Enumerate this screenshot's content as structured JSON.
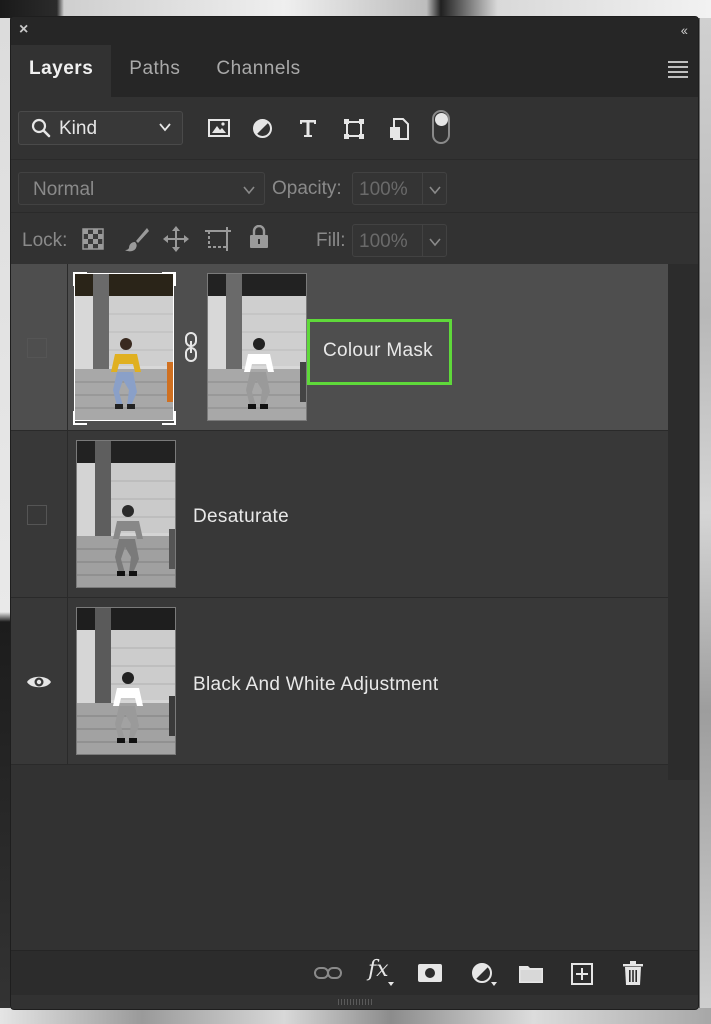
{
  "window": {
    "close_glyph": "×",
    "collapse_glyph": "‹‹"
  },
  "tabs": [
    {
      "label": "Layers",
      "active": true
    },
    {
      "label": "Paths",
      "active": false
    },
    {
      "label": "Channels",
      "active": false
    }
  ],
  "filter": {
    "kind_label": "Kind",
    "icons": [
      "image-filter-icon",
      "adjustment-filter-icon",
      "type-filter-icon",
      "shape-filter-icon",
      "smart-object-filter-icon"
    ],
    "toggle_on": true
  },
  "blend": {
    "mode": "Normal",
    "opacity_label": "Opacity:",
    "opacity_value": "100%"
  },
  "lock": {
    "label": "Lock:",
    "icons": [
      "lock-transparent-pixels-icon",
      "lock-image-pixels-icon",
      "lock-position-icon",
      "lock-artboard-icon",
      "lock-all-icon"
    ],
    "fill_label": "Fill:",
    "fill_value": "100%"
  },
  "layers": [
    {
      "name": "Colour Mask",
      "visible": false,
      "selected": true,
      "has_mask": true,
      "highlighted": true
    },
    {
      "name": "Desaturate",
      "visible": false,
      "selected": false,
      "has_mask": false
    },
    {
      "name": "Black And White Adjustment",
      "visible": true,
      "selected": false,
      "has_mask": false
    }
  ],
  "bottom_icons": [
    "link-layers-icon",
    "fx-icon",
    "add-mask-icon",
    "new-adjustment-icon",
    "new-group-icon",
    "new-layer-icon",
    "delete-icon"
  ],
  "bottom_fx_label": "fx",
  "colors": {
    "panel": "#323232",
    "selected_row": "#4e4e4e",
    "highlight": "#5fd93a",
    "thumb_yellow": "#e0b020"
  }
}
